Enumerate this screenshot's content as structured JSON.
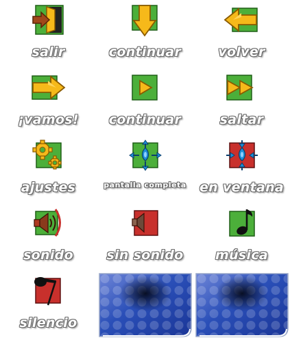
{
  "colors": {
    "green": "#4caf3a",
    "red": "#c8302c",
    "arrow": "#f6b91a",
    "blue": "#1d8fd8",
    "panel_blue": "#2a4fb8",
    "label_outline": "#6a6a6a"
  },
  "buttons": [
    {
      "label": "salir",
      "icon": "exit-door-icon"
    },
    {
      "label": "continuar",
      "icon": "arrow-down-icon"
    },
    {
      "label": "volver",
      "icon": "arrow-back-icon"
    },
    {
      "label": "¡vamos!",
      "icon": "arrow-forward-icon"
    },
    {
      "label": "continuar",
      "icon": "play-icon"
    },
    {
      "label": "saltar",
      "icon": "skip-icon"
    },
    {
      "label": "ajustes",
      "icon": "gears-icon"
    },
    {
      "label": "pantalla completa",
      "icon": "fullscreen-icon"
    },
    {
      "label": "en ventana",
      "icon": "windowed-icon"
    },
    {
      "label": "sonido",
      "icon": "speaker-on-icon"
    },
    {
      "label": "sin sonido",
      "icon": "speaker-off-icon"
    },
    {
      "label": "música",
      "icon": "music-note-icon"
    },
    {
      "label": "silencio",
      "icon": "music-off-icon"
    }
  ],
  "panels": [
    {
      "icon": "button-background-panel"
    },
    {
      "icon": "button-background-panel"
    }
  ]
}
